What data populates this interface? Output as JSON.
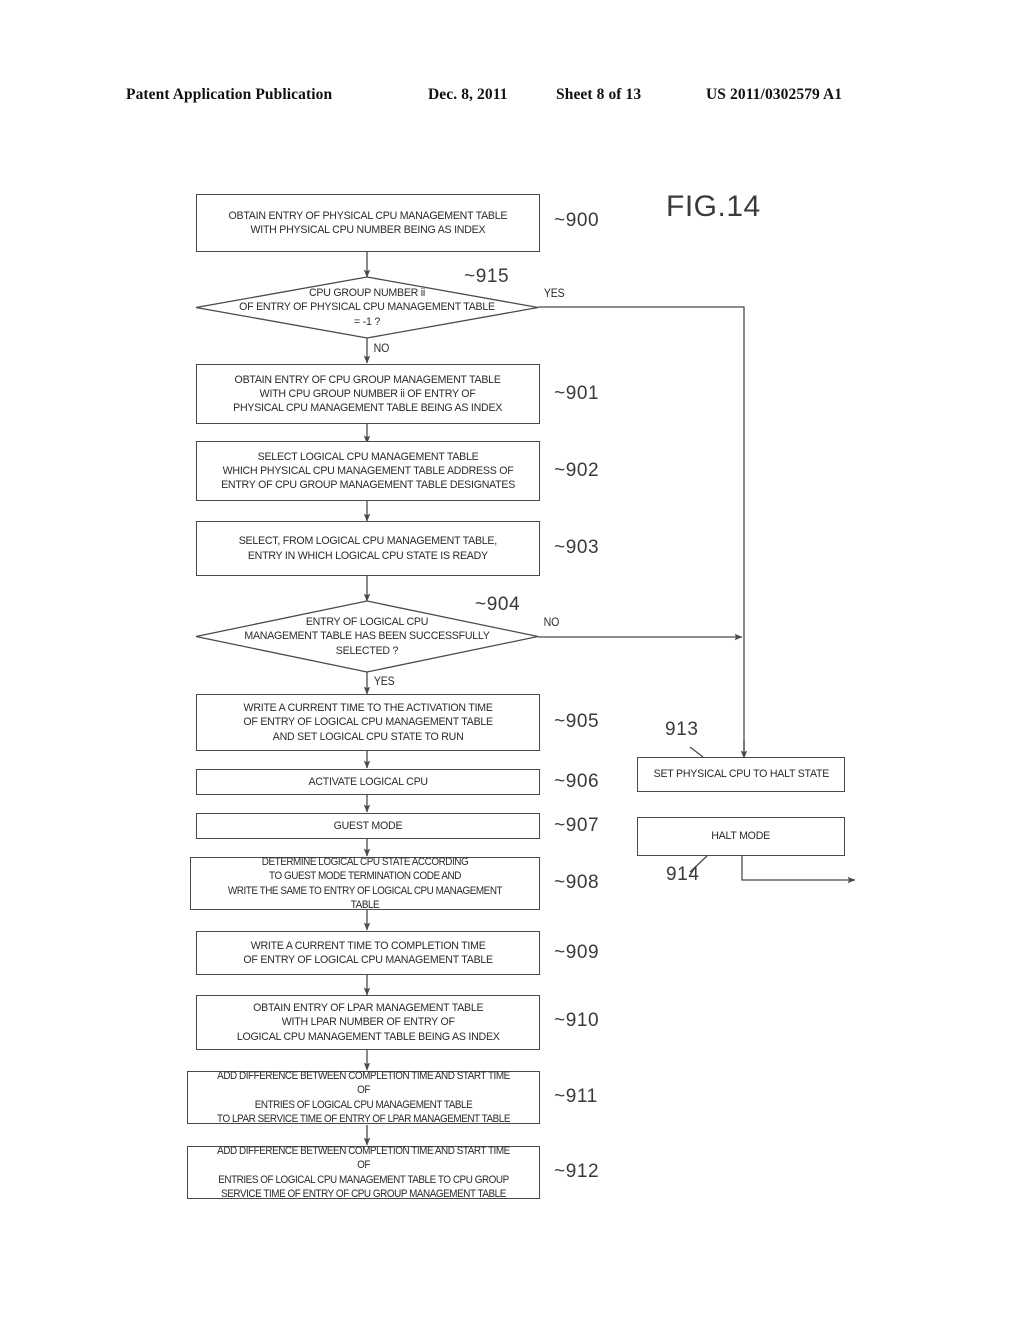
{
  "header": {
    "title": "Patent Application Publication",
    "date": "Dec. 8, 2011",
    "sheet": "Sheet 8 of 13",
    "publication_number": "US 2011/0302579 A1"
  },
  "figure": {
    "label": "FIG.14"
  },
  "flowchart": {
    "nodes": [
      {
        "id": "900",
        "ref": "900",
        "type": "process",
        "text": "OBTAIN ENTRY OF PHYSICAL CPU MANAGEMENT TABLE\nWITH PHYSICAL CPU NUMBER BEING AS INDEX"
      },
      {
        "id": "915",
        "ref": "915",
        "type": "decision",
        "text": "CPU GROUP NUMBER ii\nOF ENTRY OF PHYSICAL CPU MANAGEMENT TABLE\n= -1 ?",
        "yes_label": "YES",
        "no_label": "NO"
      },
      {
        "id": "901",
        "ref": "901",
        "type": "process",
        "text": "OBTAIN ENTRY OF CPU GROUP MANAGEMENT TABLE\nWITH CPU GROUP NUMBER ii OF ENTRY OF\nPHYSICAL CPU MANAGEMENT TABLE BEING AS INDEX"
      },
      {
        "id": "902",
        "ref": "902",
        "type": "process",
        "text": "SELECT LOGICAL CPU MANAGEMENT TABLE\nWHICH PHYSICAL CPU MANAGEMENT TABLE ADDRESS OF\nENTRY OF CPU GROUP MANAGEMENT TABLE DESIGNATES"
      },
      {
        "id": "903",
        "ref": "903",
        "type": "process",
        "text": "SELECT, FROM LOGICAL CPU MANAGEMENT TABLE,\nENTRY IN WHICH LOGICAL CPU STATE IS READY"
      },
      {
        "id": "904",
        "ref": "904",
        "type": "decision",
        "text": "ENTRY OF LOGICAL CPU\nMANAGEMENT TABLE HAS BEEN SUCCESSFULLY\nSELECTED ?",
        "yes_label": "YES",
        "no_label": "NO"
      },
      {
        "id": "905",
        "ref": "905",
        "type": "process",
        "text": "WRITE A CURRENT TIME TO THE ACTIVATION TIME\nOF ENTRY OF LOGICAL CPU MANAGEMENT TABLE\nAND SET LOGICAL CPU STATE TO RUN"
      },
      {
        "id": "906",
        "ref": "906",
        "type": "process",
        "text": "ACTIVATE LOGICAL CPU"
      },
      {
        "id": "907",
        "ref": "907",
        "type": "process",
        "text": "GUEST MODE"
      },
      {
        "id": "908",
        "ref": "908",
        "type": "process",
        "text": "DETERMINE LOGICAL CPU STATE ACCORDING\nTO GUEST MODE TERMINATION CODE AND\nWRITE THE SAME TO ENTRY OF LOGICAL CPU MANAGEMENT TABLE"
      },
      {
        "id": "909",
        "ref": "909",
        "type": "process",
        "text": "WRITE A CURRENT TIME TO COMPLETION TIME\nOF ENTRY OF LOGICAL CPU MANAGEMENT TABLE"
      },
      {
        "id": "910",
        "ref": "910",
        "type": "process",
        "text": "OBTAIN ENTRY OF LPAR MANAGEMENT TABLE\nWITH LPAR NUMBER OF ENTRY OF\nLOGICAL CPU MANAGEMENT TABLE BEING AS INDEX"
      },
      {
        "id": "911",
        "ref": "911",
        "type": "process",
        "text": "ADD DIFFERENCE BETWEEN COMPLETION TIME AND START TIME OF\nENTRIES OF LOGICAL CPU MANAGEMENT TABLE\nTO LPAR SERVICE TIME OF ENTRY OF LPAR MANAGEMENT TABLE"
      },
      {
        "id": "912",
        "ref": "912",
        "type": "process",
        "text": "ADD DIFFERENCE BETWEEN COMPLETION TIME AND START TIME OF\nENTRIES OF LOGICAL CPU MANAGEMENT TABLE TO CPU GROUP\nSERVICE TIME OF ENTRY OF CPU GROUP MANAGEMENT TABLE"
      },
      {
        "id": "913",
        "ref": "913",
        "type": "process",
        "text": "SET PHYSICAL CPU TO HALT STATE"
      },
      {
        "id": "914",
        "ref": "914",
        "type": "process",
        "text": "HALT MODE"
      }
    ]
  }
}
